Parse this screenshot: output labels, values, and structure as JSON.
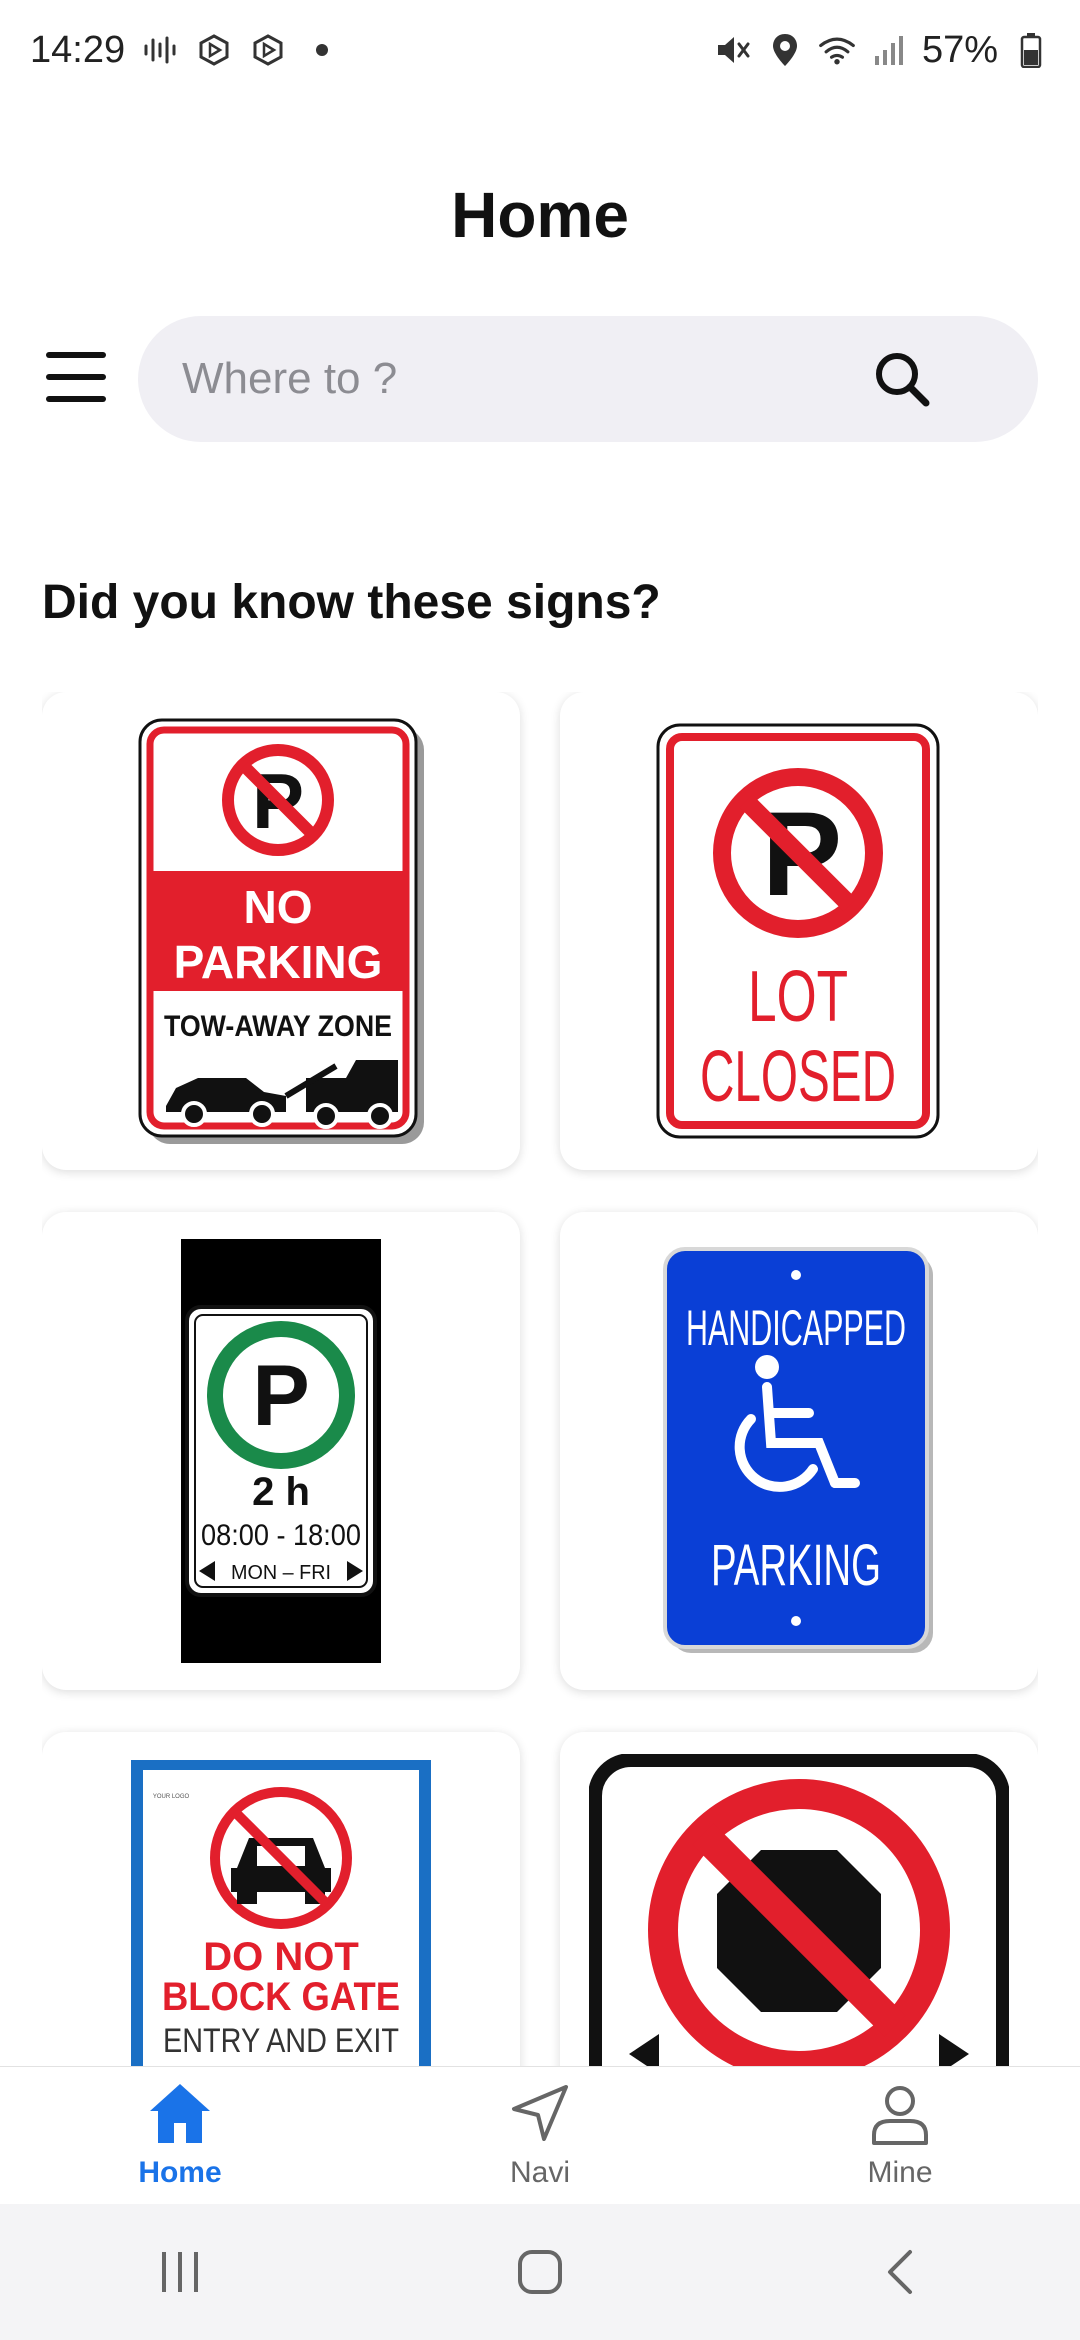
{
  "status_bar": {
    "time": "14:29",
    "battery_percent": "57%",
    "icons": [
      "audio-wave-icon",
      "app-notification-icon",
      "app-notification-icon",
      "dot-icon",
      "mute-icon",
      "location-icon",
      "wifi-icon",
      "signal-icon",
      "battery-icon"
    ]
  },
  "header": {
    "title": "Home"
  },
  "search": {
    "placeholder": "Where to ?",
    "value": ""
  },
  "section": {
    "title": "Did you know these signs?"
  },
  "signs": {
    "no_parking": {
      "line1": "NO",
      "line2": "PARKING",
      "line3": "TOW-AWAY ZONE"
    },
    "lot_closed": {
      "line1": "LOT",
      "line2": "CLOSED"
    },
    "two_hour": {
      "duration": "2 h",
      "hours": "08:00 - 18:00",
      "days": "MON – FRI"
    },
    "handicapped": {
      "line1": "HANDICAPPED",
      "line2": "PARKING"
    },
    "block_gate": {
      "logo": "YOUR LOGO",
      "line1": "DO NOT",
      "line2": "BLOCK GATE",
      "line3": "ENTRY AND EXIT"
    }
  },
  "bottom_nav": {
    "items": [
      {
        "label": "Home",
        "icon": "home-icon",
        "active": true
      },
      {
        "label": "Navi",
        "icon": "navigation-icon",
        "active": false
      },
      {
        "label": "Mine",
        "icon": "user-icon",
        "active": false
      }
    ]
  },
  "colors": {
    "accent": "#1a73e8",
    "sign_red": "#e21f2c",
    "sign_green": "#1a8a4a",
    "sign_blue": "#0a3fd6"
  }
}
